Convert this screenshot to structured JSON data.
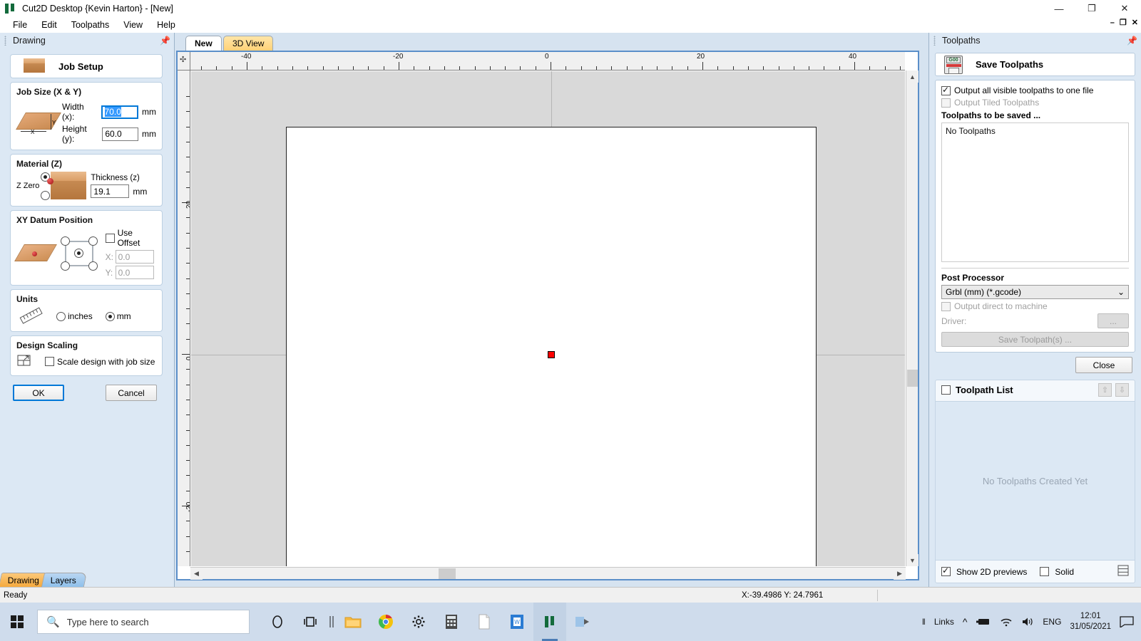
{
  "window": {
    "title": "Cut2D Desktop {Kevin Harton} - [New]",
    "icon": "app-logo-icon",
    "controls": {
      "minimize": "—",
      "maximize": "❐",
      "close": "✕"
    },
    "mdi_controls": {
      "minimize": "–",
      "restore": "❐",
      "close": "✕"
    }
  },
  "menu": {
    "items": [
      "File",
      "Edit",
      "Toolpaths",
      "View",
      "Help"
    ]
  },
  "left_panel": {
    "header": "Drawing",
    "pin_icon": "pin-icon",
    "job_setup": {
      "label": "Job Setup",
      "icon": "box-icon"
    },
    "job_size": {
      "title": "Job Size (X & Y)",
      "width_label": "Width (x):",
      "width_value": "70.0",
      "height_label": "Height (y):",
      "height_value": "60.0",
      "unit": "mm",
      "axis_x": "X",
      "axis_y": "Y"
    },
    "material": {
      "title": "Material (Z)",
      "z_zero_label": "Z Zero",
      "thickness_label": "Thickness (z)",
      "thickness_value": "19.1",
      "unit": "mm",
      "z_zero_selected": "top"
    },
    "xy_datum": {
      "title": "XY Datum Position",
      "use_offset_label": "Use Offset",
      "use_offset_checked": false,
      "x_label": "X:",
      "x_value": "0.0",
      "y_label": "Y:",
      "y_value": "0.0",
      "selected": "center"
    },
    "units": {
      "title": "Units",
      "inches_label": "inches",
      "mm_label": "mm",
      "selected": "mm"
    },
    "design_scaling": {
      "title": "Design Scaling",
      "checkbox_label": "Scale design with job size",
      "checked": false
    },
    "buttons": {
      "ok": "OK",
      "cancel": "Cancel"
    },
    "tabs": [
      {
        "label": "Drawing",
        "active": true
      },
      {
        "label": "Layers",
        "active": false
      }
    ]
  },
  "center": {
    "tabs": [
      {
        "label": "New",
        "active": true
      },
      {
        "label": "3D View",
        "active": false
      }
    ],
    "ruler_h_labels": [
      "-40",
      "-20",
      "0",
      "20",
      "40"
    ],
    "ruler_v_labels": [
      "20",
      "0",
      "-20"
    ],
    "datum_marker": "datum-marker-red"
  },
  "right_panel": {
    "header": "Toolpaths",
    "pin_icon": "pin-icon",
    "save_toolpaths": {
      "label": "Save Toolpaths",
      "icon": "floppy-disk-g00-icon"
    },
    "output_all_label": "Output all visible toolpaths to one file",
    "output_all_checked": true,
    "output_tiled_label": "Output Tiled Toolpaths",
    "output_tiled_checked": false,
    "output_tiled_disabled": true,
    "to_be_saved_title": "Toolpaths to be saved ...",
    "no_toolpaths_text": "No Toolpaths",
    "post_processor_label": "Post Processor",
    "post_processor_value": "Grbl (mm) (*.gcode)",
    "post_processor_caret": "⌄",
    "output_direct_label": "Output direct to machine",
    "output_direct_checked": false,
    "driver_label": "Driver:",
    "driver_button": "...",
    "save_toolpath_button": "Save Toolpath(s) ...",
    "close_button": "Close",
    "toolpath_list": {
      "title": "Toolpath List",
      "checked": false,
      "up_icon": "arrow-up-icon",
      "down_icon": "arrow-down-icon",
      "empty_text": "No Toolpaths Created Yet",
      "show_previews_label": "Show 2D previews",
      "show_previews_checked": true,
      "solid_label": "Solid",
      "solid_checked": false,
      "grid_icon": "grid-icon"
    }
  },
  "status_bar": {
    "ready": "Ready",
    "coordinates": "X:-39.4986 Y: 24.7961"
  },
  "taskbar": {
    "start_icon": "windows-start-icon",
    "search_placeholder": "Type here to search",
    "search_icon": "search-icon",
    "icons": [
      "cortana-icon",
      "task-view-icon",
      "separator-icon",
      "file-explorer-icon",
      "chrome-icon",
      "settings-icon",
      "calculator-icon",
      "notepad-icon",
      "word-icon",
      "cut2d-icon",
      "vcarve-icon"
    ],
    "tray": {
      "separator": "‖",
      "links_label": "Links",
      "chevron_icon": "chevron-up-icon",
      "battery_icon": "battery-icon",
      "wifi_icon": "wifi-icon",
      "volume_icon": "volume-icon",
      "language": "ENG",
      "time": "12:01",
      "date": "31/05/2021",
      "action_center_icon": "notification-icon"
    }
  },
  "colors": {
    "accent": "#0078d7",
    "panel_bg": "#dce8f4",
    "datum_red": "#ff0000",
    "tab_active": "#ffd277"
  }
}
